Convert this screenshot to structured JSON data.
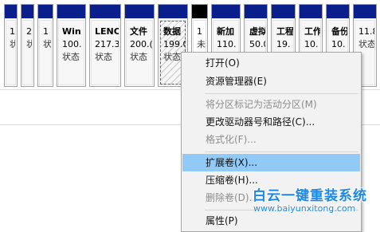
{
  "disk_map": {
    "partitions": [
      {
        "name": "",
        "size": "1(",
        "status": "状",
        "style": "plain"
      },
      {
        "name": "",
        "size": "2",
        "status": "状",
        "style": "plain"
      },
      {
        "name": "",
        "size": "1",
        "status": "状",
        "style": "plain"
      },
      {
        "name": "Win",
        "size": "100.",
        "status": "状态",
        "style": "plain"
      },
      {
        "name": "LENC",
        "size": "217.3",
        "status": "状态",
        "style": "plain"
      },
      {
        "name": "文件",
        "size": "200.(",
        "status": "状态",
        "style": "plain"
      },
      {
        "name": "数据",
        "size": "199.0",
        "status": "状态",
        "style": "hatched selected"
      },
      {
        "name": "",
        "size": "1",
        "status": "未",
        "style": "black white"
      },
      {
        "name": "新加",
        "size": "110.",
        "status": "状态",
        "style": "plain"
      },
      {
        "name": "虚拟",
        "size": "50.0",
        "status": "状态",
        "style": "plain"
      },
      {
        "name": "工程",
        "size": "19.",
        "status": "状态",
        "style": "plain"
      },
      {
        "name": "工作",
        "size": "10.",
        "status": "状态",
        "style": "plain"
      },
      {
        "name": "备份",
        "size": "10.",
        "status": "状态",
        "style": "plain"
      },
      {
        "name": "",
        "size": "11.8",
        "status": "状态",
        "style": "plain"
      }
    ]
  },
  "context_menu": {
    "items": [
      {
        "label": "打开(O)",
        "state": "enabled"
      },
      {
        "label": "资源管理器(E)",
        "state": "enabled"
      },
      {
        "label": "将分区标记为活动分区(M)",
        "state": "disabled"
      },
      {
        "label": "更改驱动器号和路径(C)...",
        "state": "enabled"
      },
      {
        "label": "格式化(F)...",
        "state": "disabled"
      },
      {
        "label": "扩展卷(X)...",
        "state": "highlighted"
      },
      {
        "label": "压缩卷(H)...",
        "state": "enabled"
      },
      {
        "label": "删除卷(D)...",
        "state": "disabled"
      },
      {
        "label": "属性(P)",
        "state": "enabled"
      }
    ]
  },
  "watermark": {
    "title": "白云一键重装系统",
    "url": "www.baiyunxitong.com"
  },
  "colors": {
    "partition_bar": "#0a1e8c",
    "highlight": "#91c9f7",
    "watermark": "#1e88e5"
  }
}
